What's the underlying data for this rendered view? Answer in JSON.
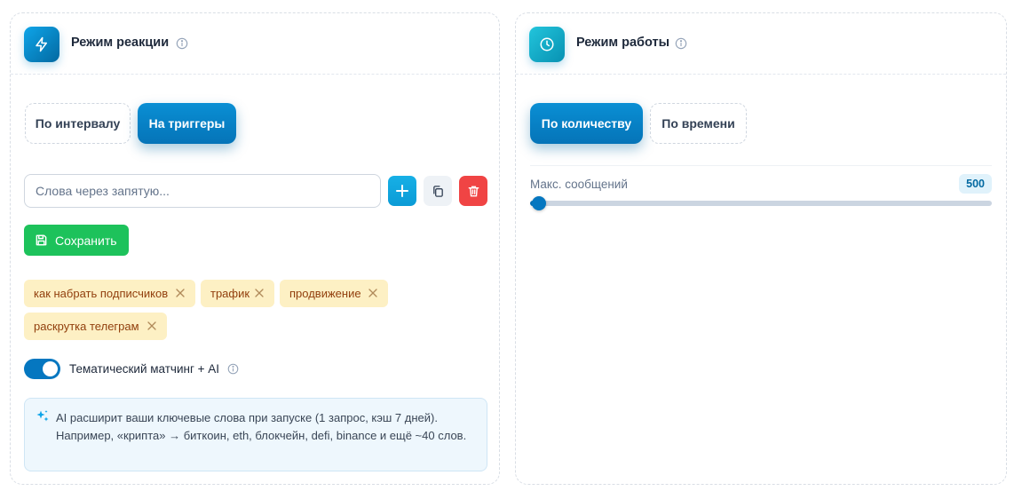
{
  "reaction_panel": {
    "title": "Режим реакции",
    "header_icon": "lightning-icon",
    "modes": [
      {
        "label": "По интервалу",
        "active": false
      },
      {
        "label": "На триггеры",
        "active": true
      }
    ],
    "keywords_input": {
      "placeholder": "Слова через запятую...",
      "value": ""
    },
    "save_label": "Сохранить",
    "tags": [
      "как набрать подписчиков",
      "трафик",
      "продвижение",
      "раскрутка телеграм"
    ],
    "toggle": {
      "label": "Тематический матчинг + AI",
      "on": true
    },
    "ai_note": "AI расширит ваши ключевые слова при запуске (1 запрос, кэш 7 дней). Например, «крипта» → биткоин, eth, блокчейн, defi, binance и ещё ~40 слов."
  },
  "work_panel": {
    "title": "Режим работы",
    "header_icon": "clock-icon",
    "modes": [
      {
        "label": "По количеству",
        "active": true
      },
      {
        "label": "По времени",
        "active": false
      }
    ],
    "slider": {
      "label": "Макс. сообщений",
      "value": "500",
      "fill_fraction": 0.02
    }
  },
  "colors": {
    "primary": "#0577c0",
    "success": "#1dc25b",
    "danger": "#f04444",
    "tag_bg": "#fdf0c4",
    "tag_text": "#92400e"
  }
}
